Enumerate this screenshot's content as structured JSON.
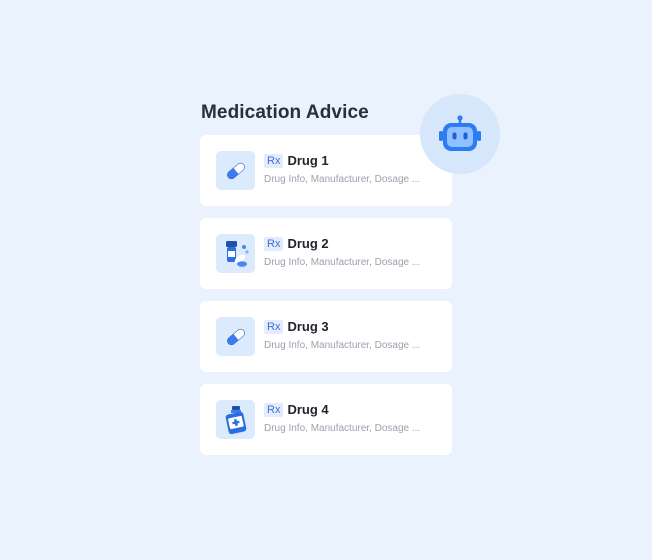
{
  "header": {
    "title": "Medication Advice"
  },
  "assistant": {
    "icon": "robot-icon",
    "accent": "#2d7cf6"
  },
  "drugs": [
    {
      "badge": "Rx",
      "name": "Drug 1",
      "meta": "Drug Info, Manufacturer, Dosage ...",
      "icon": "capsule-icon"
    },
    {
      "badge": "Rx",
      "name": "Drug 2",
      "meta": "Drug Info, Manufacturer, Dosage ...",
      "icon": "pill-bottle-icon"
    },
    {
      "badge": "Rx",
      "name": "Drug 3",
      "meta": "Drug Info, Manufacturer, Dosage ...",
      "icon": "capsule-icon"
    },
    {
      "badge": "Rx",
      "name": "Drug 4",
      "meta": "Drug Info, Manufacturer, Dosage ...",
      "icon": "medicine-bottle-icon"
    }
  ],
  "colors": {
    "background": "#eaf2fd",
    "card": "#ffffff",
    "badge_bg": "#e2ecfc",
    "badge_text": "#3d6fd6"
  }
}
